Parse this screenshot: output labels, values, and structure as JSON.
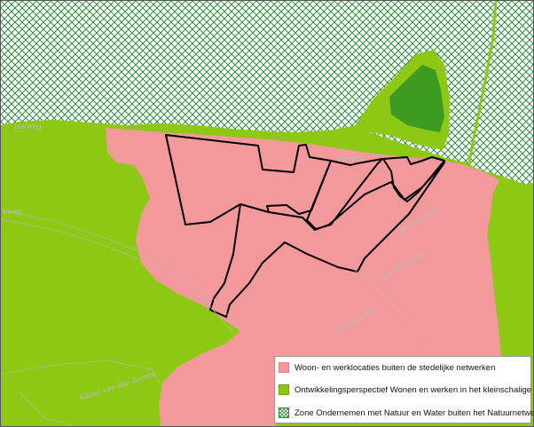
{
  "colors": {
    "woon_werk": "#f4999b",
    "mixlandschap": "#8dc814",
    "natuur_water_hatch": "#2e8b3a",
    "dark_green": "#3d9b22",
    "outline": "#000000"
  },
  "streets": [
    {
      "id": "s1",
      "text": "Jaalweg"
    },
    {
      "id": "s2",
      "text": "Maenta"
    },
    {
      "id": "s3",
      "text": "eweg"
    },
    {
      "id": "s4",
      "text": "van Dijksweg"
    },
    {
      "id": "s5",
      "text": "van Dijksweg"
    },
    {
      "id": "s6",
      "text": "van Dijksweg"
    },
    {
      "id": "s7",
      "text": "Kaiser van den Broeke"
    }
  ],
  "legend": {
    "items": [
      {
        "label": "Woon- en werklocaties buiten de stedelijke netwerken",
        "swatch": "pink"
      },
      {
        "label": "Ontwikkelingsperspectief Wonen en werken in het kleinschalige mixlandschap",
        "swatch": "green"
      },
      {
        "label": "Zone Ondernemen met Natuur en Water buiten het Natuurnetwerk Nederland",
        "swatch": "hatch"
      }
    ]
  }
}
